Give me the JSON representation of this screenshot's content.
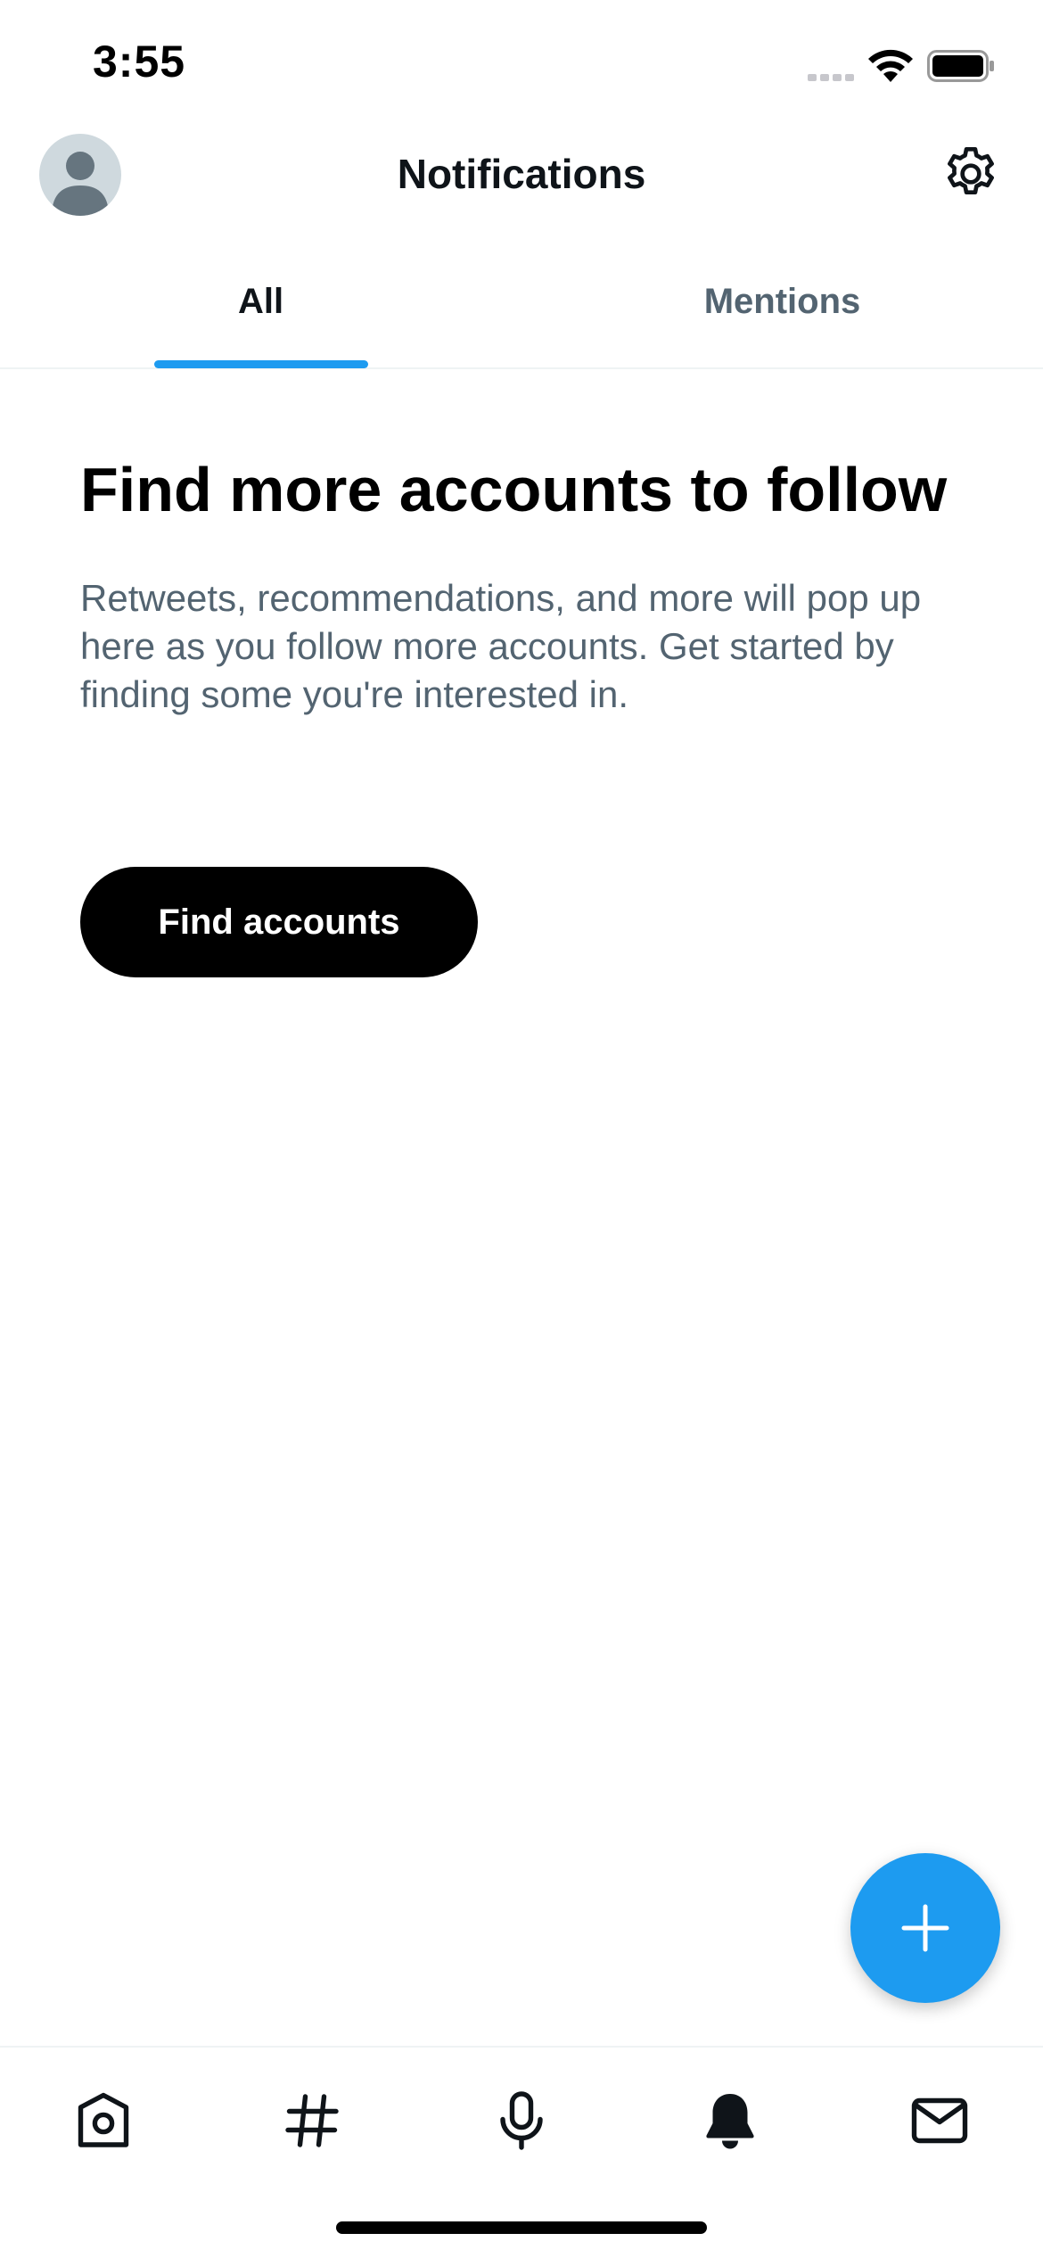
{
  "status_bar": {
    "time": "3:55",
    "signal_icon": "cellular-signal-icon",
    "wifi_icon": "wifi-icon",
    "battery_icon": "battery-icon"
  },
  "header": {
    "title": "Notifications",
    "avatar_icon": "default-avatar-icon",
    "settings_icon": "gear-icon"
  },
  "tabs": [
    {
      "label": "All",
      "selected": true
    },
    {
      "label": "Mentions",
      "selected": false
    }
  ],
  "empty_state": {
    "title": "Find more accounts to follow",
    "description": "Retweets, recommendations, and more will pop up here as you follow more accounts. Get started by finding some you're interested in.",
    "button_label": "Find accounts"
  },
  "fab": {
    "icon": "plus-icon"
  },
  "bottom_nav": [
    {
      "icon": "home-icon",
      "active": false
    },
    {
      "icon": "hashtag-icon",
      "active": false
    },
    {
      "icon": "microphone-icon",
      "active": false
    },
    {
      "icon": "bell-icon",
      "active": true
    },
    {
      "icon": "mail-icon",
      "active": false
    }
  ],
  "colors": {
    "accent": "#1d9bf0",
    "text_primary": "#0f1419",
    "text_secondary": "#536471",
    "divider": "#eff3f4",
    "button_bg": "#000000"
  }
}
